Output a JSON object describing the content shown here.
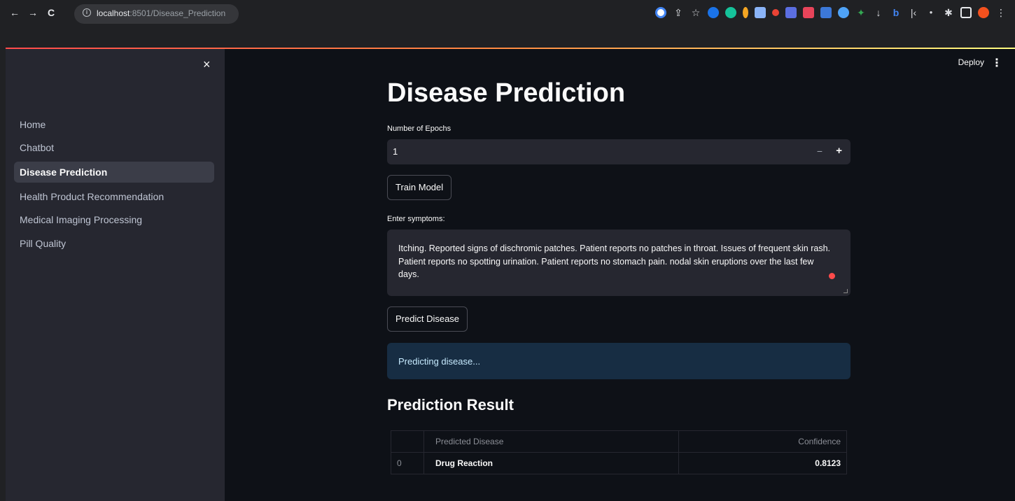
{
  "browser": {
    "url_host": "localhost",
    "url_path": ":8501/Disease_Prediction",
    "back": "←",
    "forward": "→",
    "reload": "C"
  },
  "sidebar": {
    "close": "×",
    "items": [
      {
        "label": "Home",
        "active": false
      },
      {
        "label": "Chatbot",
        "active": false
      },
      {
        "label": "Disease Prediction",
        "active": true
      },
      {
        "label": "Health Product Recommendation",
        "active": false
      },
      {
        "label": "Medical Imaging Processing",
        "active": false
      },
      {
        "label": "Pill Quality",
        "active": false
      }
    ]
  },
  "header": {
    "deploy_label": "Deploy",
    "menu": "⋮"
  },
  "main": {
    "title": "Disease Prediction",
    "epochs": {
      "label": "Number of Epochs",
      "value": "1",
      "minus": "−",
      "plus": "+"
    },
    "train_button": "Train Model",
    "symptoms": {
      "label": "Enter symptoms:",
      "value": "Itching. Reported signs of dischromic patches. Patient reports no patches in throat. Issues of frequent skin rash. Patient reports no spotting urination. Patient reports no stomach pain. nodal skin eruptions over the last few days."
    },
    "predict_button": "Predict Disease",
    "info_message": "Predicting disease...",
    "result_heading": "Prediction Result",
    "table": {
      "columns": [
        "",
        "Predicted Disease",
        "Confidence"
      ],
      "rows": [
        [
          "0",
          "Drug Reaction",
          "0.8123"
        ]
      ]
    }
  },
  "colors": {
    "accent": "#ff4b4b",
    "background": "#0e1117",
    "sidebar": "#262730",
    "info_bg": "#172d43"
  }
}
